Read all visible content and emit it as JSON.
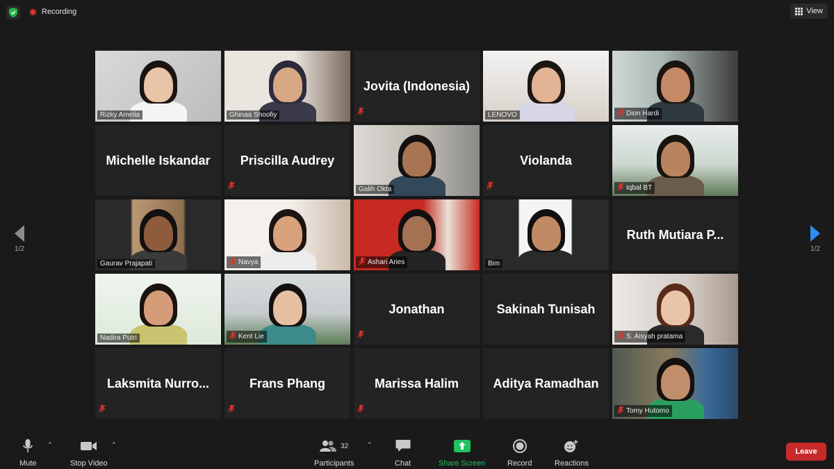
{
  "topbar": {
    "recording_label": "Recording",
    "view_label": "View",
    "icons": [
      "shield-icon",
      "recording-icon",
      "grid-view-icon"
    ]
  },
  "pager": {
    "left_label": "1/2",
    "right_label": "1/2"
  },
  "participants": [
    {
      "name": "Rizky Amelia",
      "video": true,
      "muted": false,
      "active": true
    },
    {
      "name": "Ghinaa Shoofiy",
      "video": true,
      "muted": false
    },
    {
      "name": "Jovita (Indonesia)",
      "video": false,
      "muted": true
    },
    {
      "name": "LENOVO",
      "video": true,
      "muted": false
    },
    {
      "name": "Dion Hardi",
      "video": true,
      "muted": true
    },
    {
      "name": "Michelle Iskandar",
      "video": false,
      "muted": false
    },
    {
      "name": "Priscilla Audrey",
      "video": false,
      "muted": true
    },
    {
      "name": "Galih Okta",
      "video": true,
      "muted": false
    },
    {
      "name": "Violanda",
      "video": false,
      "muted": true
    },
    {
      "name": "Iqbal BT",
      "video": true,
      "muted": true
    },
    {
      "name": "Gaurav Prajapati",
      "video": true,
      "muted": false
    },
    {
      "name": "Navya",
      "video": true,
      "muted": true
    },
    {
      "name": "Ashari Aries",
      "video": true,
      "muted": true
    },
    {
      "name": "Bim",
      "video": true,
      "muted": false
    },
    {
      "name": "Ruth Mutiara P...",
      "video": false,
      "muted": false
    },
    {
      "name": "Nadira Putri",
      "video": true,
      "muted": false
    },
    {
      "name": "Kent Lie",
      "video": true,
      "muted": true
    },
    {
      "name": "Jonathan",
      "video": false,
      "muted": true
    },
    {
      "name": "Sakinah Tunisah",
      "video": false,
      "muted": false
    },
    {
      "name": "S. Aisyah pratama",
      "video": true,
      "muted": true
    },
    {
      "name": "Laksmita  Nurro...",
      "video": false,
      "muted": true
    },
    {
      "name": "Frans Phang",
      "video": false,
      "muted": true
    },
    {
      "name": "Marissa Halim",
      "video": false,
      "muted": true
    },
    {
      "name": "Aditya Ramadhan",
      "video": false,
      "muted": false
    },
    {
      "name": "Tomy Hutomo",
      "video": true,
      "muted": true
    }
  ],
  "toolbar": {
    "mute_label": "Mute",
    "stop_video_label": "Stop Video",
    "participants_label": "Participants",
    "participants_count": "32",
    "chat_label": "Chat",
    "share_screen_label": "Share Screen",
    "record_label": "Record",
    "reactions_label": "Reactions",
    "leave_label": "Leave"
  },
  "colors": {
    "background": "#1a1a1a",
    "tile": "#232323",
    "active_speaker": "#d7e86b",
    "share_green": "#20c160",
    "leave_red": "#c82a2a",
    "mute_red": "#e0302a",
    "next_arrow": "#2e8cf0"
  }
}
